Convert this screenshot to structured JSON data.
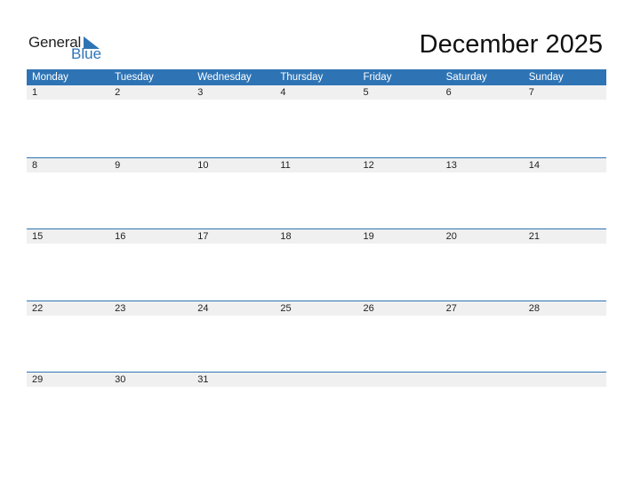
{
  "logo": {
    "word1": "General",
    "word2": "Blue",
    "icon": "triangle-flag-icon"
  },
  "title": "December 2025",
  "colors": {
    "accent": "#2e74b5",
    "row_bg": "#f0f0f0"
  },
  "weekdays": [
    "Monday",
    "Tuesday",
    "Wednesday",
    "Thursday",
    "Friday",
    "Saturday",
    "Sunday"
  ],
  "weeks": [
    [
      "1",
      "2",
      "3",
      "4",
      "5",
      "6",
      "7"
    ],
    [
      "8",
      "9",
      "10",
      "11",
      "12",
      "13",
      "14"
    ],
    [
      "15",
      "16",
      "17",
      "18",
      "19",
      "20",
      "21"
    ],
    [
      "22",
      "23",
      "24",
      "25",
      "26",
      "27",
      "28"
    ],
    [
      "29",
      "30",
      "31",
      "",
      "",
      "",
      ""
    ]
  ]
}
